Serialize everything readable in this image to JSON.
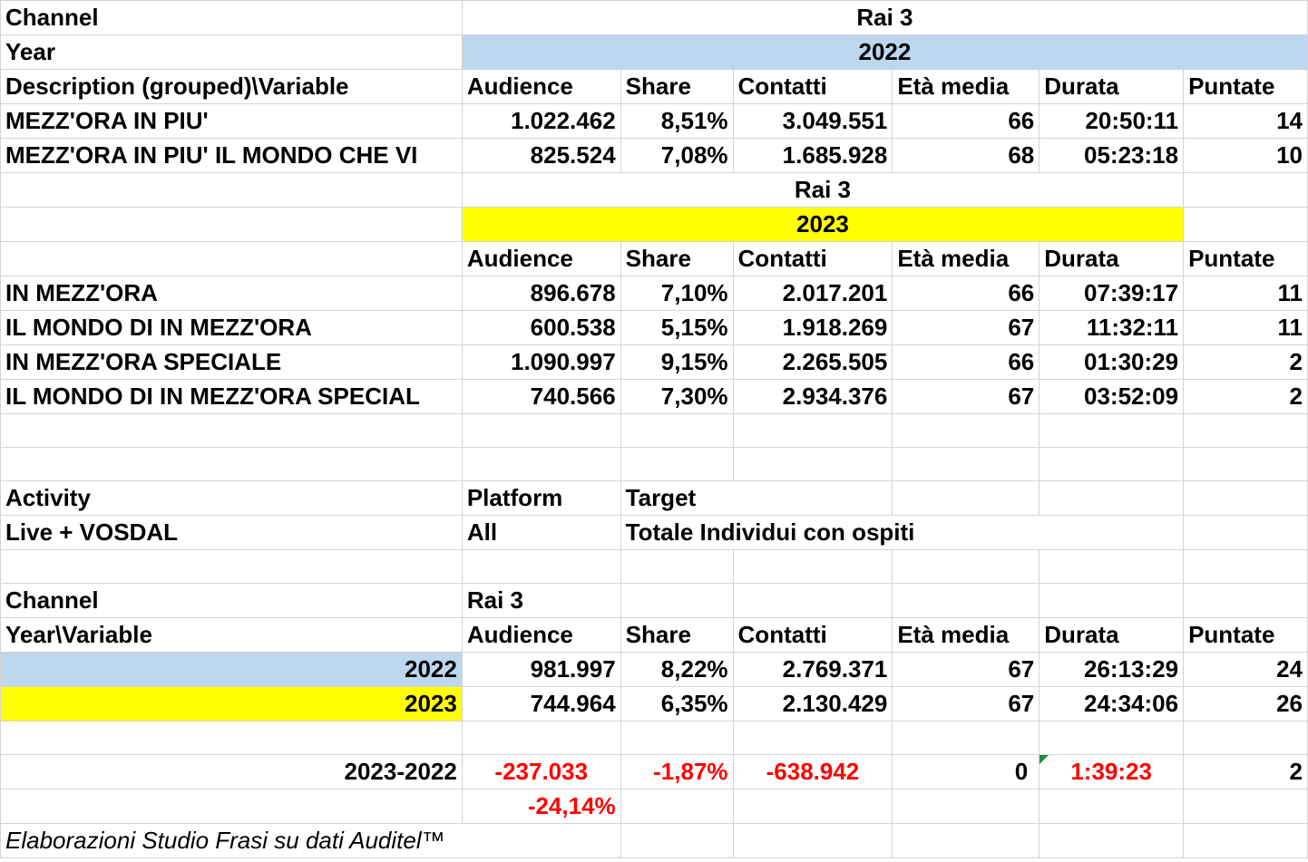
{
  "top": {
    "channel_label": "Channel",
    "channel_value": "Rai 3",
    "year_label": "Year",
    "year_value": "2022",
    "header_label": "Description (grouped)\\Variable",
    "columns": [
      "Audience",
      "Share",
      "Contatti",
      "Età media",
      "Durata",
      "Puntate"
    ],
    "rows": [
      {
        "desc": "MEZZ'ORA IN PIU'",
        "values": [
          "1.022.462",
          "8,51%",
          "3.049.551",
          "66",
          "20:50:11",
          "14"
        ]
      },
      {
        "desc": "MEZZ'ORA IN PIU' IL MONDO CHE VI",
        "values": [
          "825.524",
          "7,08%",
          "1.685.928",
          "68",
          "05:23:18",
          "10"
        ]
      }
    ]
  },
  "second": {
    "channel_value": "Rai 3",
    "year_value": "2023",
    "columns": [
      "Audience",
      "Share",
      "Contatti",
      "Età media",
      "Durata",
      "Puntate"
    ],
    "rows": [
      {
        "desc": "IN MEZZ'ORA",
        "values": [
          "896.678",
          "7,10%",
          "2.017.201",
          "66",
          "07:39:17",
          "11"
        ]
      },
      {
        "desc": "IL MONDO DI IN MEZZ'ORA",
        "values": [
          "600.538",
          "5,15%",
          "1.918.269",
          "67",
          "11:32:11",
          "11"
        ]
      },
      {
        "desc": "IN MEZZ'ORA SPECIALE",
        "values": [
          "1.090.997",
          "9,15%",
          "2.265.505",
          "66",
          "01:30:29",
          "2"
        ]
      },
      {
        "desc": "IL MONDO DI IN MEZZ'ORA SPECIAL",
        "values": [
          "740.566",
          "7,30%",
          "2.934.376",
          "67",
          "03:52:09",
          "2"
        ]
      }
    ]
  },
  "meta": {
    "activity_label": "Activity",
    "platform_label": "Platform",
    "target_label": "Target",
    "activity_value": "Live + VOSDAL",
    "platform_value": "All",
    "target_value": "Totale Individui con ospiti"
  },
  "summary": {
    "channel_label": "Channel",
    "channel_value": "Rai 3",
    "header_label": "Year\\Variable",
    "columns": [
      "Audience",
      "Share",
      "Contatti",
      "Età media",
      "Durata",
      "Puntate"
    ],
    "rows": [
      {
        "year": "2022",
        "values": [
          "981.997",
          "8,22%",
          "2.769.371",
          "67",
          "26:13:29",
          "24"
        ]
      },
      {
        "year": "2023",
        "values": [
          "744.964",
          "6,35%",
          "2.130.429",
          "67",
          "24:34:06",
          "26"
        ]
      }
    ],
    "diff_label": "2023-2022",
    "diff_values": [
      "-237.033",
      "-1,87%",
      "-638.942",
      "0",
      "1:39:23",
      "2"
    ],
    "diff_pct": "-24,14%"
  },
  "footer": {
    "note": "Elaborazioni Studio Frasi su dati Auditel™"
  },
  "colors": {
    "year_2022_fill": "#bdd7ee",
    "year_2023_fill": "#ffff00",
    "negative_text": "#ff0000",
    "grid": "#d4d4d4"
  }
}
